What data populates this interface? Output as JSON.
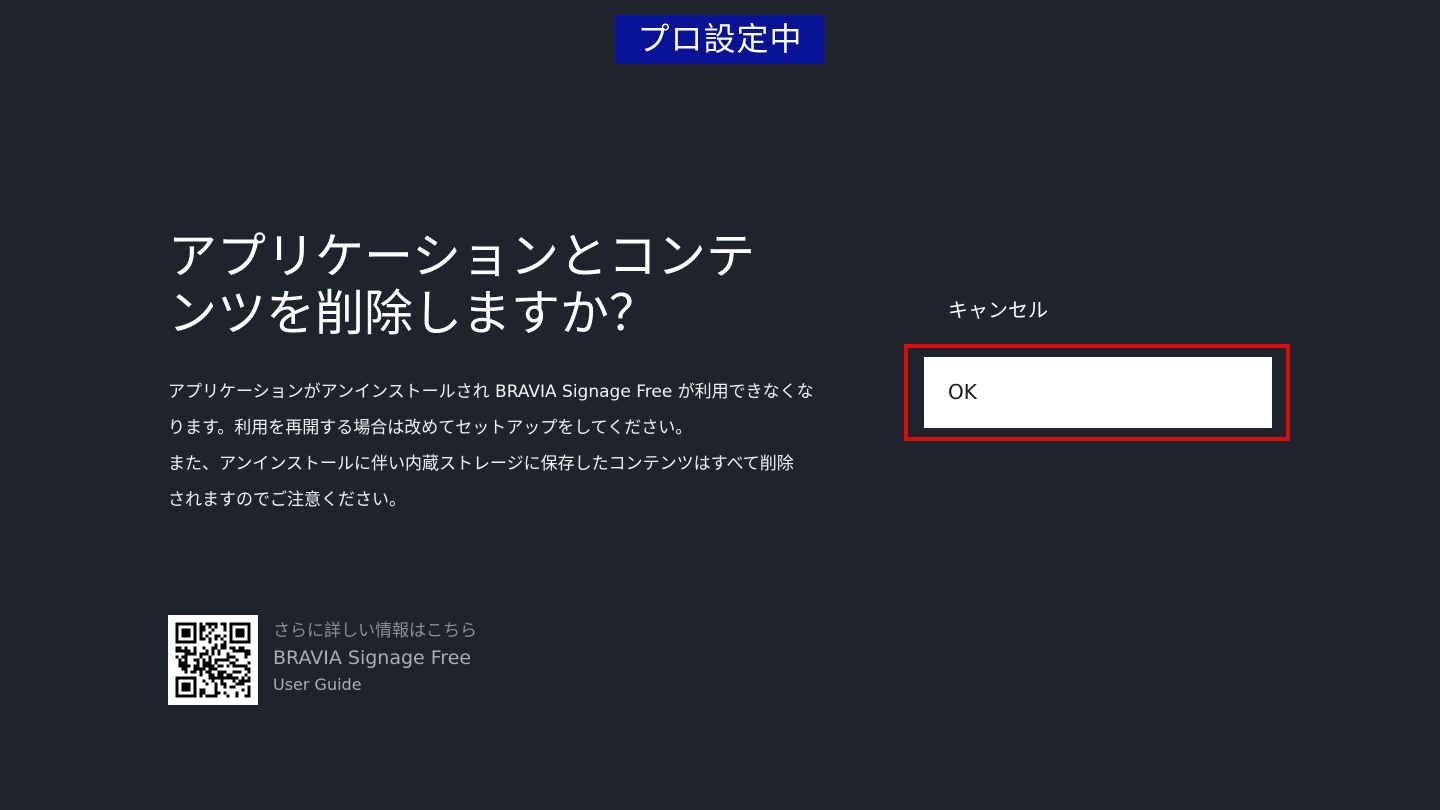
{
  "badge": {
    "label": "プロ設定中",
    "background": "#0a1296"
  },
  "dialog": {
    "title_line1": "アプリケーションとコンテ",
    "title_line2": "ンツを削除しますか？",
    "description": [
      "アプリケーションがアンインストールされ BRAVIA Signage Free が利用できなくな",
      "ります。利用を再開する場合は改めてセットアップをしてください。",
      "また、アンインストールに伴い内蔵ストレージに保存したコンテンツはすべて削除",
      "されますのでご注意ください。"
    ]
  },
  "info": {
    "heading": "さらに詳しい情報はこちら",
    "product": "BRAVIA Signage Free",
    "guide": "User Guide",
    "qr_icon": "qr-code-icon"
  },
  "options": {
    "cancel_label": "キャンセル",
    "ok_label": "OK",
    "focus_color": "#dd0b0b"
  },
  "colors": {
    "background": "#1f232d",
    "text": "#ffffff",
    "muted_text": "#8b8f97"
  }
}
